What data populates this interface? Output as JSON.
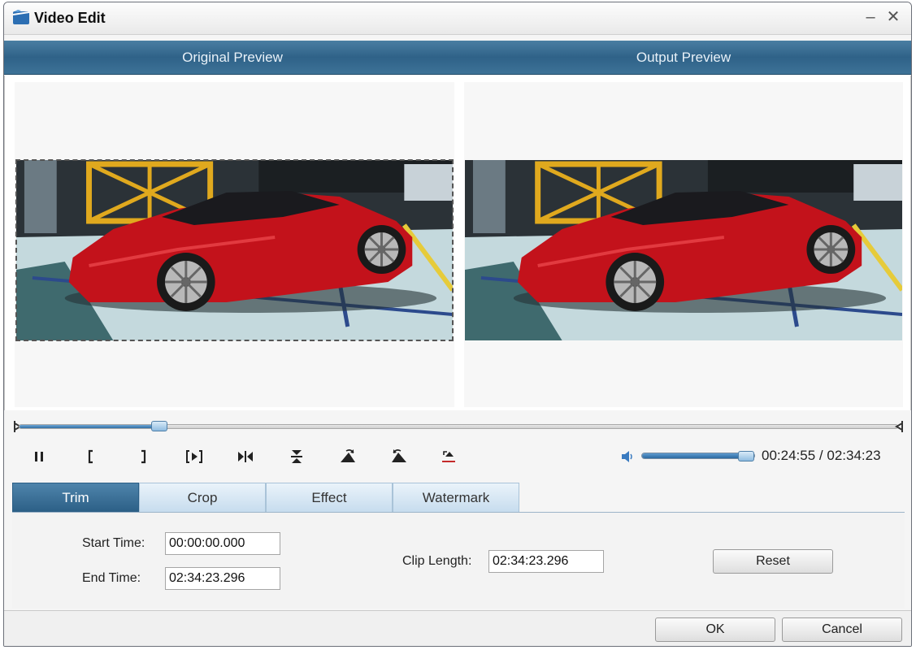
{
  "window": {
    "title": "Video Edit",
    "minimize_glyph": "–",
    "close_glyph": "✕"
  },
  "preview": {
    "original_label": "Original Preview",
    "output_label": "Output Preview"
  },
  "playback": {
    "progress": 0.16,
    "current_time": "00:24:55",
    "separator": " / ",
    "total_time": "02:34:23",
    "volume": 0.93
  },
  "controls": [
    {
      "name": "pause-icon"
    },
    {
      "name": "set-start-icon"
    },
    {
      "name": "set-end-icon"
    },
    {
      "name": "play-segment-icon"
    },
    {
      "name": "split-icon"
    },
    {
      "name": "flip-vertical-icon"
    },
    {
      "name": "rotate-right-icon"
    },
    {
      "name": "rotate-left-icon"
    },
    {
      "name": "undo-icon"
    }
  ],
  "tabs": [
    {
      "label": "Trim",
      "active": true
    },
    {
      "label": "Crop",
      "active": false
    },
    {
      "label": "Effect",
      "active": false
    },
    {
      "label": "Watermark",
      "active": false
    }
  ],
  "trim": {
    "start_label": "Start Time:",
    "start_value": "00:00:00.000",
    "end_label": "End Time:",
    "end_value": "02:34:23.296",
    "clip_label": "Clip Length:",
    "clip_value": "02:34:23.296",
    "reset_label": "Reset"
  },
  "footer": {
    "ok_label": "OK",
    "cancel_label": "Cancel"
  },
  "colors": {
    "accent": "#2f6288",
    "tab_active": "#3a6e95",
    "slider": "#2f6ea4"
  }
}
